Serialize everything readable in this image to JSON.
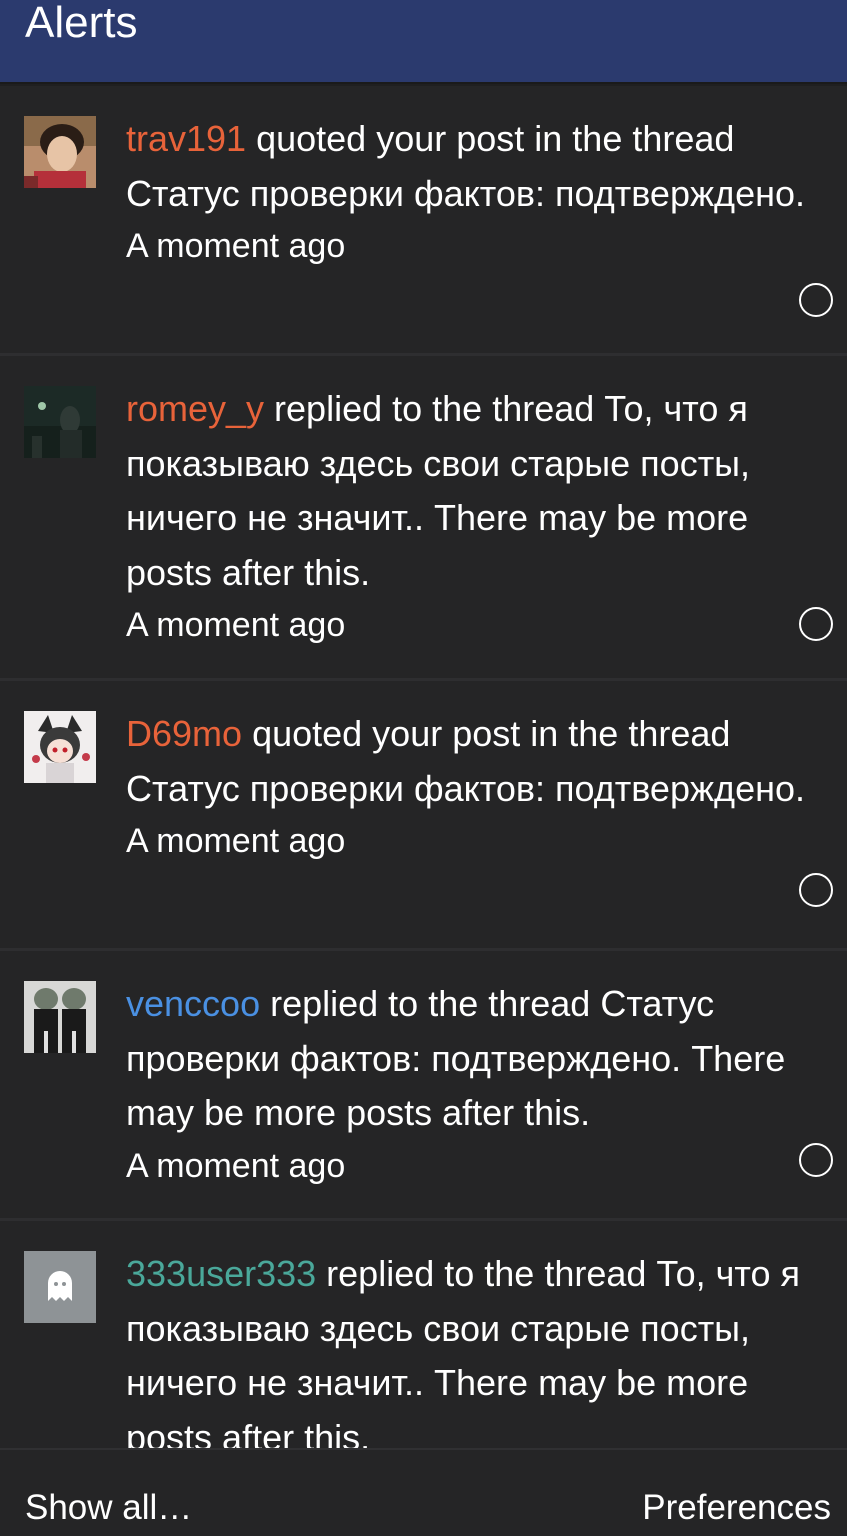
{
  "header": {
    "title": "Alerts"
  },
  "colors": {
    "header_bg": "#2b3a6e",
    "row_bg": "#252526",
    "user_orange": "#e8633a",
    "user_blue": "#4a90e2",
    "user_teal": "#4aa89a"
  },
  "alerts": [
    {
      "username": "trav191",
      "user_color": "#e8633a",
      "action": " quoted your post in the thread Статус проверки фактов: подтверждено.",
      "time": "A moment ago",
      "avatar": "photo-avatar-red"
    },
    {
      "username": "romey_y",
      "user_color": "#e8633a",
      "action": " replied to the thread То, что я показываю здесь свои старые посты, ничего не значит.. There may be more posts after this.",
      "time": "A moment ago",
      "avatar": "photo-avatar-dark"
    },
    {
      "username": "D69mo",
      "user_color": "#e8633a",
      "action": " quoted your post in the thread Статус проверки фактов: подтверждено.",
      "time": "A moment ago",
      "avatar": "anime-avatar"
    },
    {
      "username": "venccoo",
      "user_color": "#4a90e2",
      "action": " replied to the thread Статус проверки фактов: подтверждено. There may be more posts after this.",
      "time": "A moment ago",
      "avatar": "photo-avatar-figures"
    },
    {
      "username": "333user333",
      "user_color": "#4aa89a",
      "action": " replied to the thread То, что я показываю здесь свои старые посты, ничего не значит.. There may be more posts after this.",
      "time": "",
      "avatar": "ghost-icon"
    }
  ],
  "footer": {
    "show_all": "Show all…",
    "preferences": "Preferences"
  }
}
